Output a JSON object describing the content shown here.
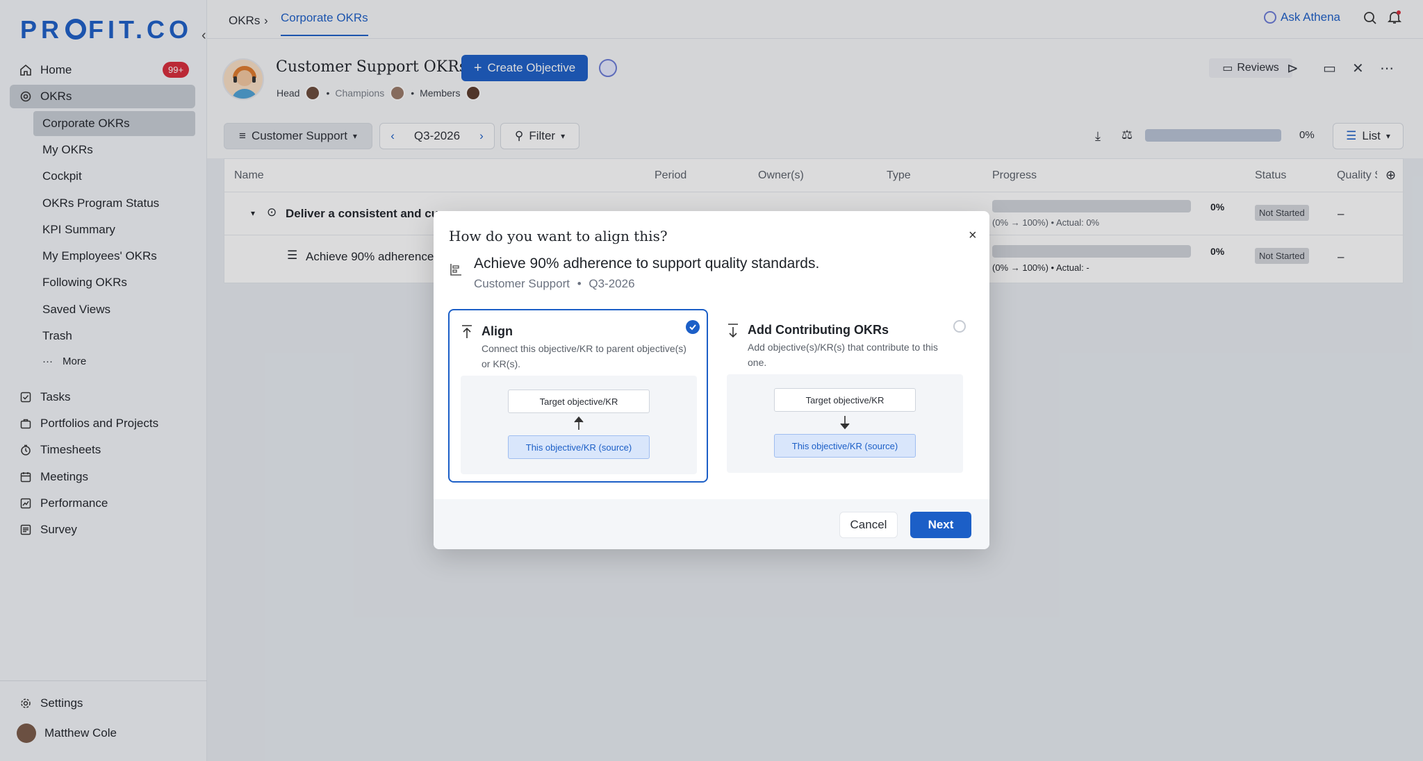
{
  "sidebar": {
    "logo": "PROFIT.CO",
    "home": "Home",
    "home_badge": "99+",
    "okrs": "OKRs",
    "sub_items": [
      "Corporate OKRs",
      "My OKRs",
      "Cockpit",
      "OKRs Program Status",
      "KPI Summary",
      "My Employees' OKRs",
      "Following OKRs",
      "Saved Views",
      "Trash"
    ],
    "more": "More",
    "items": [
      "Tasks",
      "Portfolios and Projects",
      "Timesheets",
      "Meetings",
      "Performance",
      "Survey"
    ],
    "settings": "Settings",
    "user": "Matthew Cole"
  },
  "topbar": {
    "crumb_root": "OKRs",
    "crumb_current": "Corporate OKRs",
    "ask": "Ask Athena"
  },
  "header": {
    "title": "Customer Support OKRs",
    "create": "Create Objective",
    "head_label": "Head",
    "champions_label": "Champions",
    "members_label": "Members",
    "reviews": "Reviews"
  },
  "toolbar": {
    "team": "Customer Support",
    "period": "Q3-2026",
    "filter": "Filter",
    "progress": "0%",
    "view": "List"
  },
  "table": {
    "headers": [
      "Name",
      "Period",
      "Owner(s)",
      "Type",
      "Progress",
      "Status",
      "Quality S"
    ],
    "rows": [
      {
        "name": "Deliver a consistent and cu",
        "progress": "0%",
        "progress_detail": "(0% → 100%) • Actual: 0%",
        "status": "Not Started",
        "quality": "–"
      },
      {
        "name": "Achieve 90% adherence",
        "progress": "0%",
        "progress_detail": "(0% → 100%) • Actual: -",
        "status": "Not Started",
        "quality": "–"
      }
    ]
  },
  "modal": {
    "title": "How do you want to align this?",
    "object_title": "Achieve 90% adherence to support quality standards.",
    "object_team": "Customer Support",
    "object_period": "Q3-2026",
    "align": {
      "title": "Align",
      "desc": "Connect this objective/KR to parent objective(s) or KR(s).",
      "target": "Target objective/KR",
      "source": "This objective/KR (source)"
    },
    "contribute": {
      "title": "Add Contributing OKRs",
      "desc": "Add objective(s)/KR(s) that contribute to this one.",
      "target": "Target objective/KR",
      "source": "This objective/KR (source)"
    },
    "cancel": "Cancel",
    "next": "Next"
  },
  "colors": {
    "brand": "#1c5fc7",
    "badge": "#d92b3a"
  }
}
